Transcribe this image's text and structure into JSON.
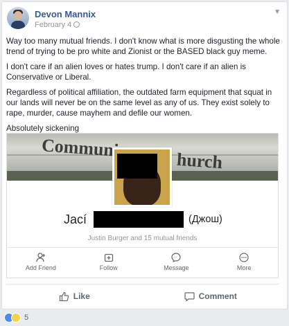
{
  "post": {
    "author": "Devon Mannix",
    "date": "February 4",
    "paragraphs": [
      "Way too many mutual friends. I don't know what is more disgusting the whole trend of trying to be pro white and Zionist or the BASED black guy meme.",
      "I don't care if an alien loves or hates trump. I don't care if an alien is Conservative or Liberal.",
      "Regardless of political affiliation, the outdated farm equipment that squat in our lands will never be on the same level as any of us. They exist solely to rape, murder, cause mayhem and defile our women.",
      "Absolutely sickening"
    ]
  },
  "shared_profile": {
    "banner_left": "Communi",
    "banner_right": "hurch",
    "first_name": "Jací",
    "last_name": "(Джош)",
    "mutual": "Justin Burger and 15 mutual friends",
    "actions": [
      {
        "label": "Add Friend",
        "icon": "add-friend-icon"
      },
      {
        "label": "Follow",
        "icon": "follow-icon"
      },
      {
        "label": "Message",
        "icon": "messenger-icon"
      },
      {
        "label": "More",
        "icon": "more-icon"
      }
    ]
  },
  "footer": {
    "like": "Like",
    "comment": "Comment"
  },
  "reactions": {
    "count": "5"
  }
}
